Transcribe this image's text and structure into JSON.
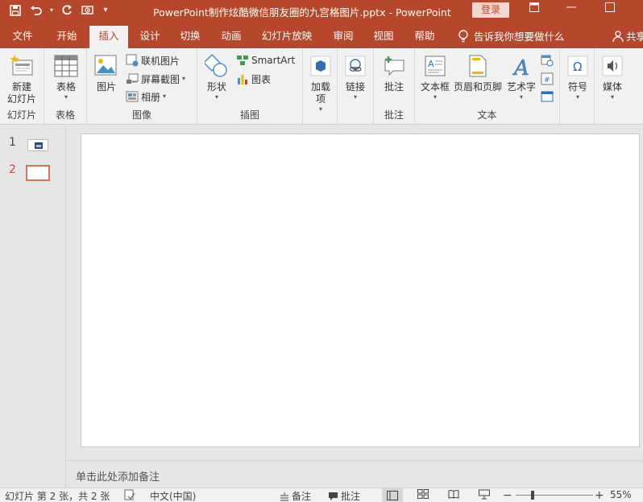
{
  "window": {
    "title": "PowerPoint制作炫酷微信朋友圈的九宫格图片.pptx  -  PowerPoint",
    "login": "登录",
    "accent": "#b7472a"
  },
  "tabs": [
    "文件",
    "开始",
    "插入",
    "设计",
    "切换",
    "动画",
    "幻灯片放映",
    "审阅",
    "视图",
    "帮助"
  ],
  "active_tab": "插入",
  "tellme": "告诉我你想要做什么",
  "share": "共享",
  "ribbon": {
    "slides": {
      "new_slide": "新建\n幻灯片",
      "label": "幻灯片"
    },
    "tables": {
      "table": "表格",
      "label": "表格"
    },
    "images": {
      "picture": "图片",
      "online": "联机图片",
      "screenshot": "屏幕截图",
      "album": "相册",
      "label": "图像"
    },
    "illustrations": {
      "shapes": "形状",
      "smartart": "SmartArt",
      "chart": "图表",
      "label": "插图"
    },
    "addins": {
      "addins": "加载\n项"
    },
    "links": {
      "link": "链接"
    },
    "comments": {
      "comment": "批注",
      "label": "批注"
    },
    "text": {
      "textbox": "文本框",
      "header": "页眉和页脚",
      "wordart": "艺术字",
      "label": "文本"
    },
    "symbols": {
      "symbol": "符号"
    },
    "media": {
      "media": "媒体"
    }
  },
  "thumbnails": [
    {
      "num": "1"
    },
    {
      "num": "2"
    }
  ],
  "notes_placeholder": "单击此处添加备注",
  "status": {
    "slide_info": "幻灯片 第 2 张，共 2 张",
    "language": "中文(中国)",
    "notes": "备注",
    "comments": "批注",
    "zoom": "55%"
  }
}
